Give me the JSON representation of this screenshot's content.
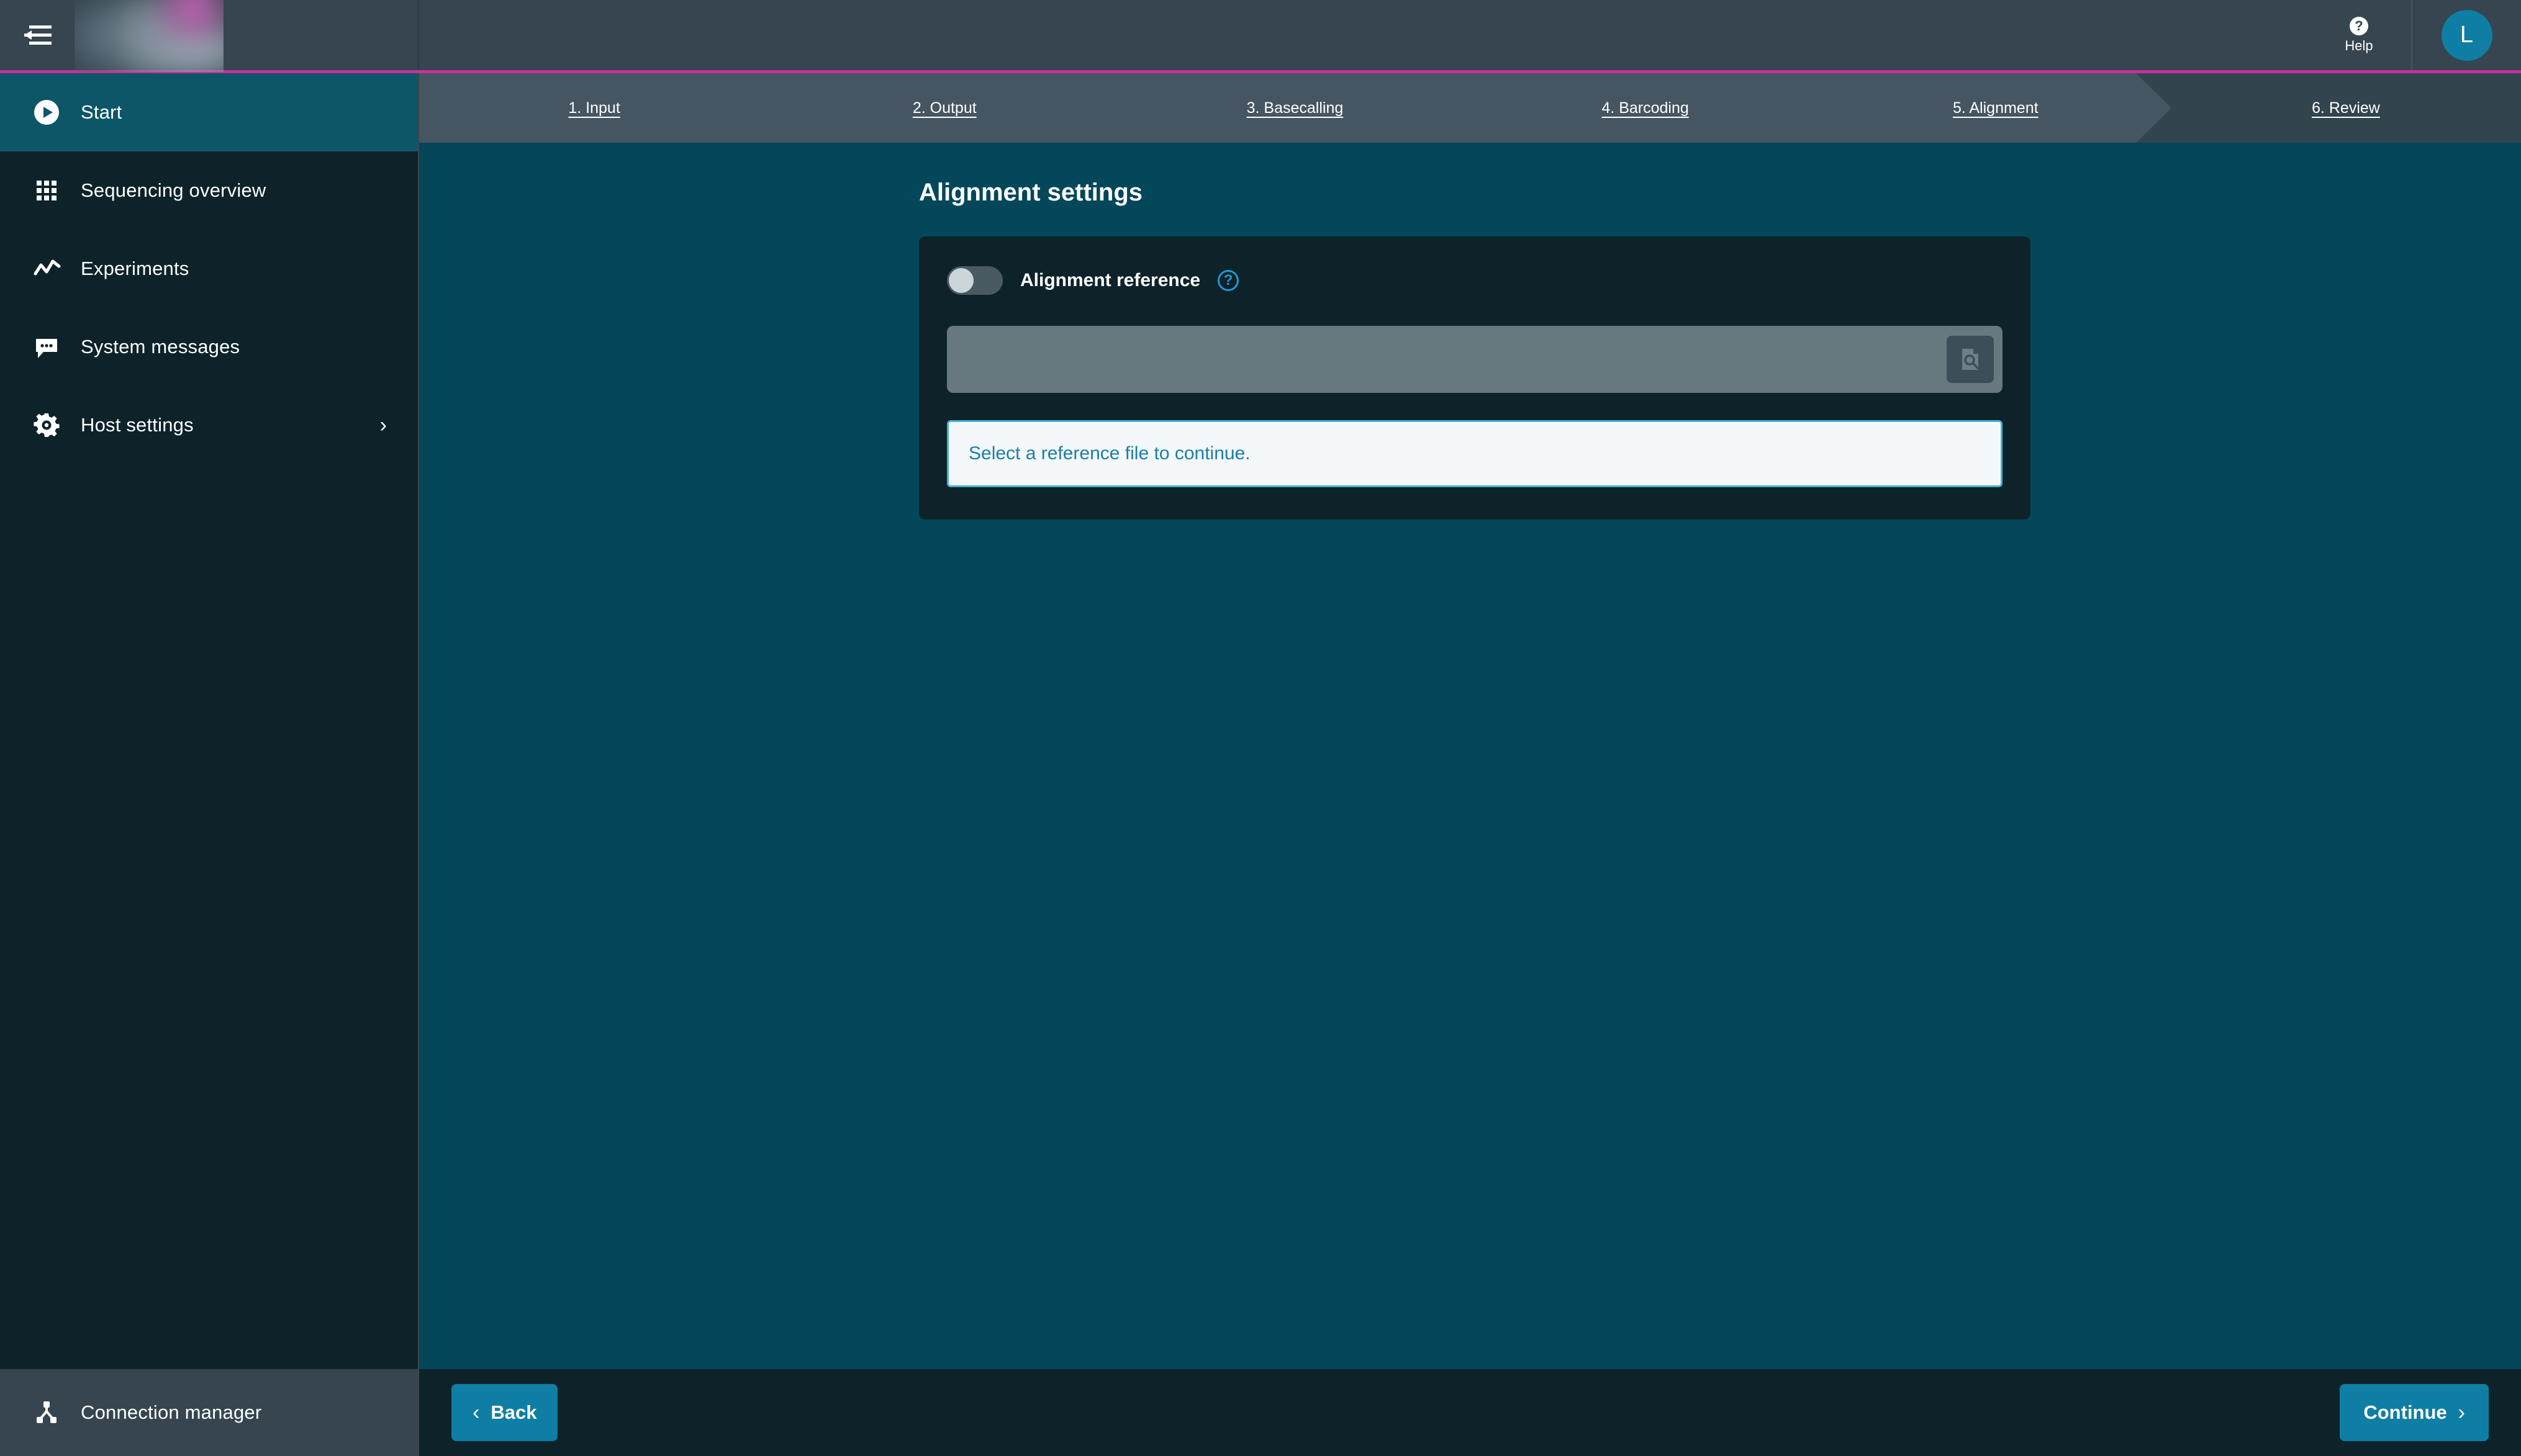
{
  "topbar": {
    "collapse_icon": "collapse-sidebar-icon",
    "logo": "redacted-brand-logo",
    "help_glyph": "?",
    "help_label": "Help",
    "avatar_initial": "L",
    "accent_color": "#c6319c"
  },
  "sidebar": {
    "items": [
      {
        "label": "Start",
        "icon": "play-circle-icon",
        "active": true,
        "has_chevron": false
      },
      {
        "label": "Sequencing overview",
        "icon": "grid-icon",
        "active": false,
        "has_chevron": false
      },
      {
        "label": "Experiments",
        "icon": "line-chart-icon",
        "active": false,
        "has_chevron": false
      },
      {
        "label": "System messages",
        "icon": "speech-bubble-icon",
        "active": false,
        "has_chevron": false
      },
      {
        "label": "Host settings",
        "icon": "gear-icon",
        "active": false,
        "has_chevron": true
      }
    ],
    "footer": {
      "label": "Connection manager",
      "icon": "network-node-icon"
    },
    "active_bg": "#0d5668",
    "bg": "#0d2329"
  },
  "steps": {
    "items": [
      {
        "label": "1. Input",
        "current": false
      },
      {
        "label": "2. Output",
        "current": false
      },
      {
        "label": "3. Basecalling",
        "current": false
      },
      {
        "label": "4. Barcoding",
        "current": false
      },
      {
        "label": "5. Alignment",
        "current": false
      },
      {
        "label": "6. Review",
        "current": true
      }
    ],
    "bg": "#455561",
    "current_bg": "#32444e"
  },
  "main": {
    "page_title": "Alignment settings",
    "card": {
      "toggle": {
        "label": "Alignment reference",
        "state": "off",
        "help_glyph": "?",
        "help_icon": "question-circle-icon"
      },
      "file_field": {
        "value": "",
        "placeholder": "",
        "browse_icon": "file-search-icon",
        "disabled": true
      },
      "alert": {
        "text": "Select a reference file to continue.",
        "border_color": "#49b3d8",
        "text_color": "#1a7fa8",
        "bg_color": "#f4f8fa"
      }
    },
    "bg": "#04475a"
  },
  "footer": {
    "back_label": "Back",
    "back_icon": "chevron-left-icon",
    "back_glyph": "‹",
    "continue_label": "Continue",
    "continue_icon": "chevron-right-icon",
    "continue_glyph": "›",
    "button_color": "#0f7ea4"
  }
}
